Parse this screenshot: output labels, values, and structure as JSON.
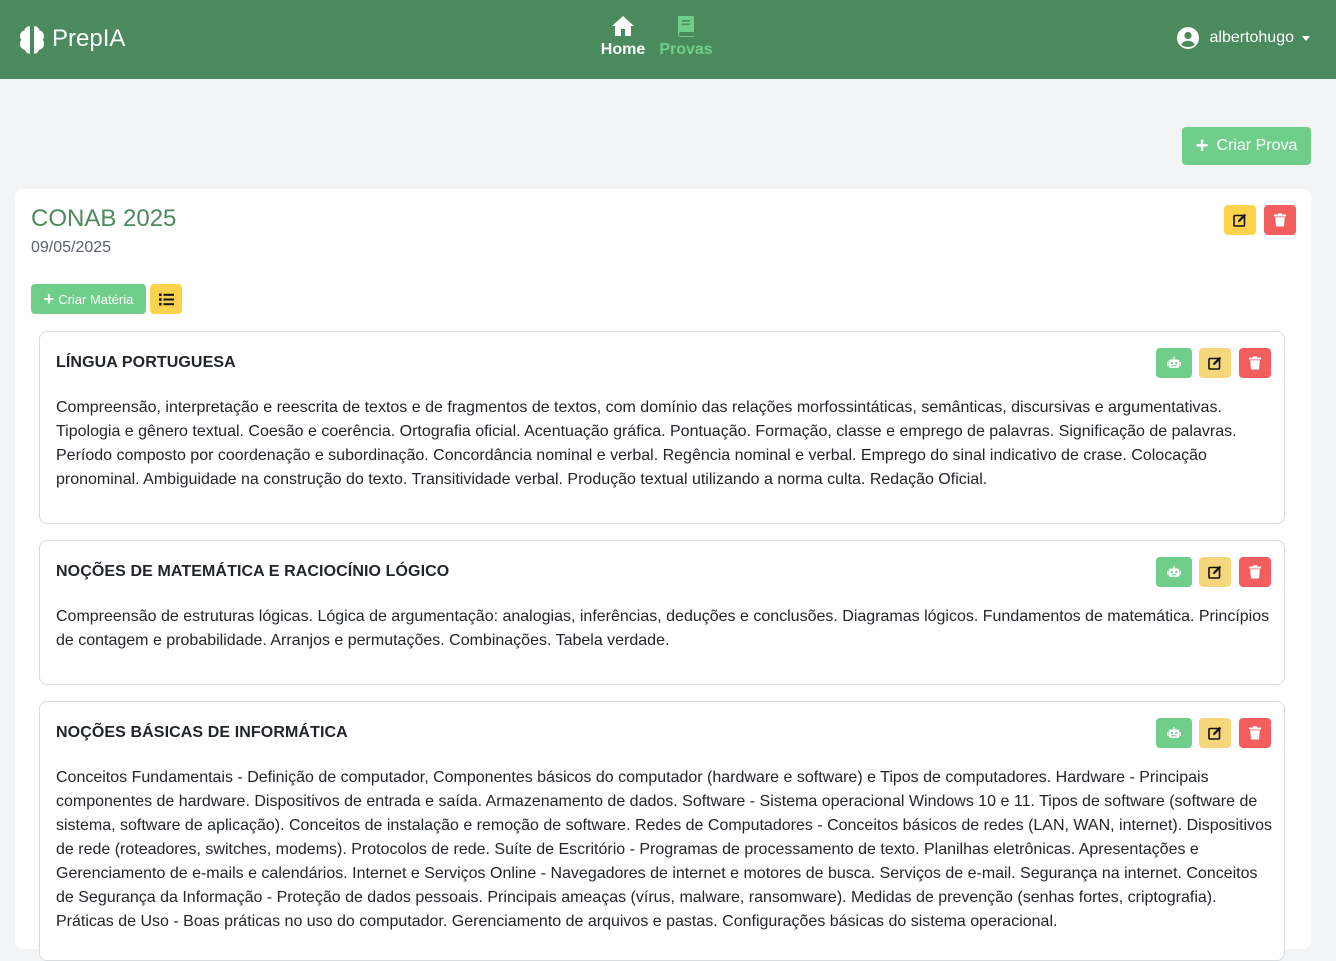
{
  "navbar": {
    "brand": "PrepIA",
    "nav": [
      {
        "label": "Home",
        "icon": "home-icon",
        "active": false
      },
      {
        "label": "Provas",
        "icon": "book-icon",
        "active": true
      }
    ],
    "user": {
      "name": "albertohugo",
      "icon": "user-circle-icon"
    }
  },
  "actions": {
    "criar_prova_label": "Criar Prova"
  },
  "prova": {
    "title": "CONAB 2025",
    "date": "09/05/2025",
    "criar_materia_label": "Criar Matéria"
  },
  "materias": [
    {
      "title": "LÍNGUA PORTUGUESA",
      "body": "Compreensão, interpretação e reescrita de textos e de fragmentos de textos, com domínio das relações morfossintáticas, semânticas, discursivas e argumentativas. Tipologia e gênero textual. Coesão e coerência. Ortografia oficial. Acentuação gráfica. Pontuação. Formação, classe e emprego de palavras. Significação de palavras. Período composto por coordenação e subordinação. Concordância nominal e verbal. Regência nominal e verbal. Emprego do sinal indicativo de crase. Colocação pronominal. Ambiguidade na construção do texto. Transitividade verbal. Produção textual utilizando a norma culta. Redação Oficial."
    },
    {
      "title": "NOÇÕES DE MATEMÁTICA E RACIOCÍNIO LÓGICO",
      "body": "Compreensão de estruturas lógicas. Lógica de argumentação: analogias, inferências, deduções e conclusões. Diagramas lógicos. Fundamentos de matemática. Princípios de contagem e probabilidade. Arranjos e permutações. Combinações. Tabela verdade."
    },
    {
      "title": "NOÇÕES BÁSICAS DE INFORMÁTICA",
      "body": "Conceitos Fundamentais - Definição de computador, Componentes básicos do computador (hardware e software) e Tipos de computadores. Hardware - Principais componentes de hardware. Dispositivos de entrada e saída. Armazenamento de dados. Software - Sistema operacional Windows 10 e 11. Tipos de software (software de sistema, software de aplicação). Conceitos de instalação e remoção de software. Redes de Computadores - Conceitos básicos de redes (LAN, WAN, internet). Dispositivos de rede (roteadores, switches, modems). Protocolos de rede. Suíte de Escritório - Programas de processamento de texto. Planilhas eletrônicas. Apresentações e Gerenciamento de e-mails e calendários. Internet e Serviços Online - Navegadores de internet e motores de busca. Serviços de e-mail. Segurança na internet. Conceitos de Segurança da Informação - Proteção de dados pessoais. Principais ameaças (vírus, malware, ransomware). Medidas de prevenção (senhas fortes, criptografia). Práticas de Uso - Boas práticas no uso do computador. Gerenciamento de arquivos e pastas. Configurações básicas do sistema operacional."
    }
  ],
  "colors": {
    "navbar": "#4a8a5c",
    "accent_green": "#6fcf8a",
    "warning": "#ffd24d",
    "danger": "#f25e5e",
    "background": "#f3f4f6"
  }
}
